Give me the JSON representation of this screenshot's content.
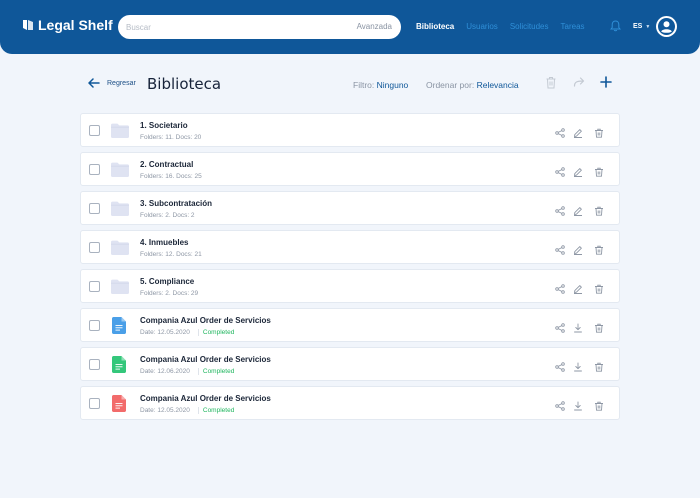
{
  "header": {
    "logo_text": "Legal Shelf",
    "search_placeholder": "Buscar",
    "search_advanced": "Avanzada",
    "nav": [
      {
        "label": "Biblioteca",
        "active": true
      },
      {
        "label": "Usuarios",
        "active": false
      },
      {
        "label": "Solicitudes",
        "active": false
      },
      {
        "label": "Tareas",
        "active": false
      }
    ],
    "language": "ES"
  },
  "toolbar": {
    "back_label": "Regresar",
    "title": "Biblioteca",
    "filter_label": "Filtro:",
    "filter_value": "Ninguno",
    "sort_label": "Ordenar por:",
    "sort_value": "Relevancia"
  },
  "items": [
    {
      "type": "folder",
      "name": "1. Societario",
      "meta": "Folders: 11. Docs: 20"
    },
    {
      "type": "folder",
      "name": "2. Contractual",
      "meta": "Folders: 16. Docs: 25"
    },
    {
      "type": "folder",
      "name": "3. Subcontratación",
      "meta": "Folders: 2. Docs: 2"
    },
    {
      "type": "folder",
      "name": "4. Inmuebles",
      "meta": "Folders: 12. Docs: 21"
    },
    {
      "type": "folder",
      "name": "5. Compliance",
      "meta": "Folders: 2. Docs: 29"
    },
    {
      "type": "doc",
      "name": "Compania Azul Order de Servicios",
      "meta": "Date: 12.05.2020",
      "status": "Completed",
      "icon_color": "#4a9fe8"
    },
    {
      "type": "doc",
      "name": "Compania Azul Order de Servicios",
      "meta": "Date: 12.06.2020",
      "status": "Completed",
      "icon_color": "#34c77b"
    },
    {
      "type": "doc",
      "name": "Compania Azul Order de Servicios",
      "meta": "Date: 12.05.2020",
      "status": "Completed",
      "icon_color": "#f26b6b"
    }
  ],
  "colors": {
    "header_bg": "#0f5799",
    "accent": "#0f5799",
    "status_completed": "#20b65f",
    "folder": "#dfe3f2"
  }
}
